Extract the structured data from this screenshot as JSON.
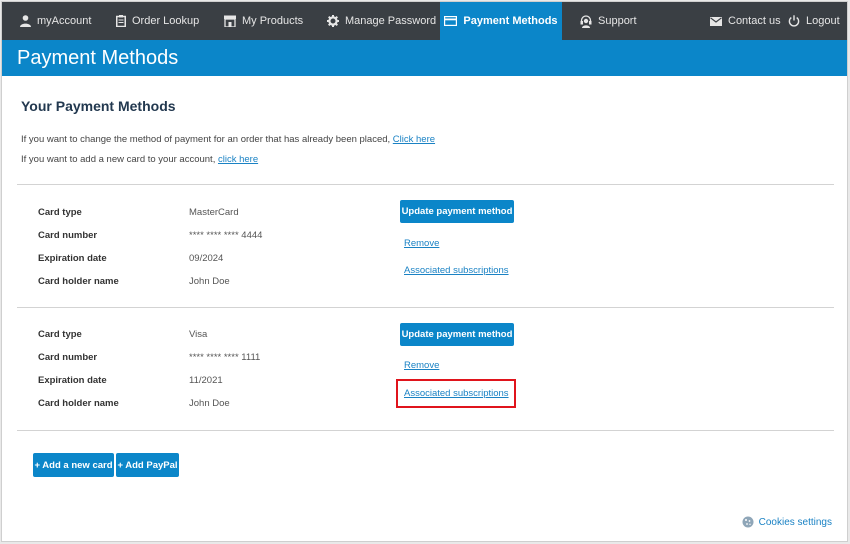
{
  "nav": {
    "items": [
      {
        "label": "myAccount",
        "icon": "user-icon"
      },
      {
        "label": "Order Lookup",
        "icon": "clipboard-icon"
      },
      {
        "label": "My Products",
        "icon": "store-icon"
      },
      {
        "label": "Manage Password",
        "icon": "gear-icon"
      },
      {
        "label": "Payment Methods",
        "icon": "credit-card-icon",
        "active": true
      },
      {
        "label": "Support",
        "icon": "support-icon"
      }
    ],
    "contact_label": "Contact us",
    "logout_label": "Logout"
  },
  "page": {
    "title": "Payment Methods",
    "section_title": "Your Payment Methods",
    "change_text": "If you want to change the method of payment for an order that has already been placed, ",
    "change_link": "Click here",
    "add_text": "If you want to add a new card to your account, ",
    "add_link": "click here"
  },
  "card_labels": {
    "type": "Card type",
    "number": "Card number",
    "expiration": "Expiration date",
    "holder": "Card holder name"
  },
  "cards": [
    {
      "type": "MasterCard",
      "number": "**** **** **** 4444",
      "expiration": "09/2024",
      "holder": "John Doe",
      "update_label": "Update payment method",
      "remove_label": "Remove",
      "subscriptions_label": "Associated subscriptions"
    },
    {
      "type": "Visa",
      "number": "**** **** **** 1111",
      "expiration": "11/2021",
      "holder": "John Doe",
      "update_label": "Update payment method",
      "remove_label": "Remove",
      "subscriptions_label": "Associated subscriptions"
    }
  ],
  "actions": {
    "add_card_label": "+ Add a new card",
    "add_paypal_label": "+ Add PayPal"
  },
  "footer": {
    "cookies_label": "Cookies settings"
  },
  "colors": {
    "nav_bg": "#3a3f44",
    "accent": "#0b86c9",
    "link": "#1a82c4",
    "highlight": "#e0141c"
  }
}
